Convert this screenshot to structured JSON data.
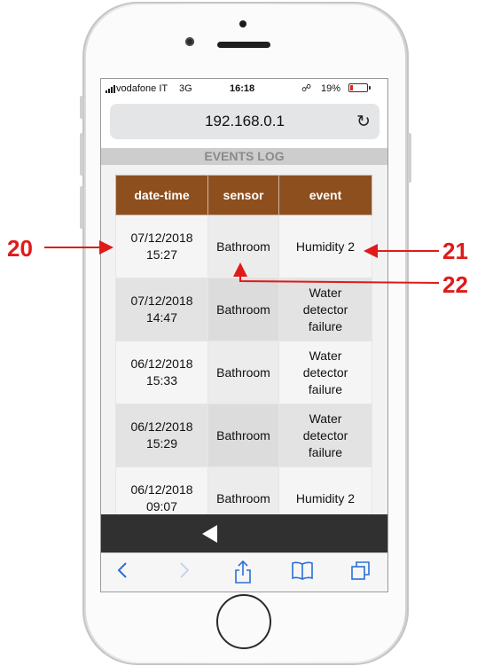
{
  "status_bar": {
    "carrier": "vodafone IT",
    "network": "3G",
    "time": "16:18",
    "battery_percent": "19%",
    "battery_level": 0.19,
    "battery_color": "#e8231f"
  },
  "browser": {
    "url": "192.168.0.1",
    "reload_icon": "reload-icon"
  },
  "page": {
    "section_title": "EVENTS LOG",
    "table": {
      "header_color": "#8e4f1e",
      "columns": [
        "date-time",
        "sensor",
        "event"
      ],
      "rows": [
        {
          "date": "07/12/2018",
          "time": "15:27",
          "sensor": "Bathroom",
          "event": [
            "Humidity 2"
          ]
        },
        {
          "date": "07/12/2018",
          "time": "14:47",
          "sensor": "Bathroom",
          "event": [
            "Water",
            "detector",
            "failure"
          ]
        },
        {
          "date": "06/12/2018",
          "time": "15:33",
          "sensor": "Bathroom",
          "event": [
            "Water",
            "detector",
            "failure"
          ]
        },
        {
          "date": "06/12/2018",
          "time": "15:29",
          "sensor": "Bathroom",
          "event": [
            "Water",
            "detector",
            "failure"
          ]
        },
        {
          "date": "06/12/2018",
          "time": "09:07",
          "sensor": "Bathroom",
          "event": [
            "Humidity 2"
          ]
        }
      ]
    }
  },
  "toolbar": {
    "items": [
      "back-icon",
      "forward-icon",
      "share-icon",
      "bookmarks-icon",
      "tabs-icon"
    ]
  },
  "annotations": {
    "color": "#e01a1a",
    "labels": [
      "20",
      "21",
      "22"
    ]
  }
}
